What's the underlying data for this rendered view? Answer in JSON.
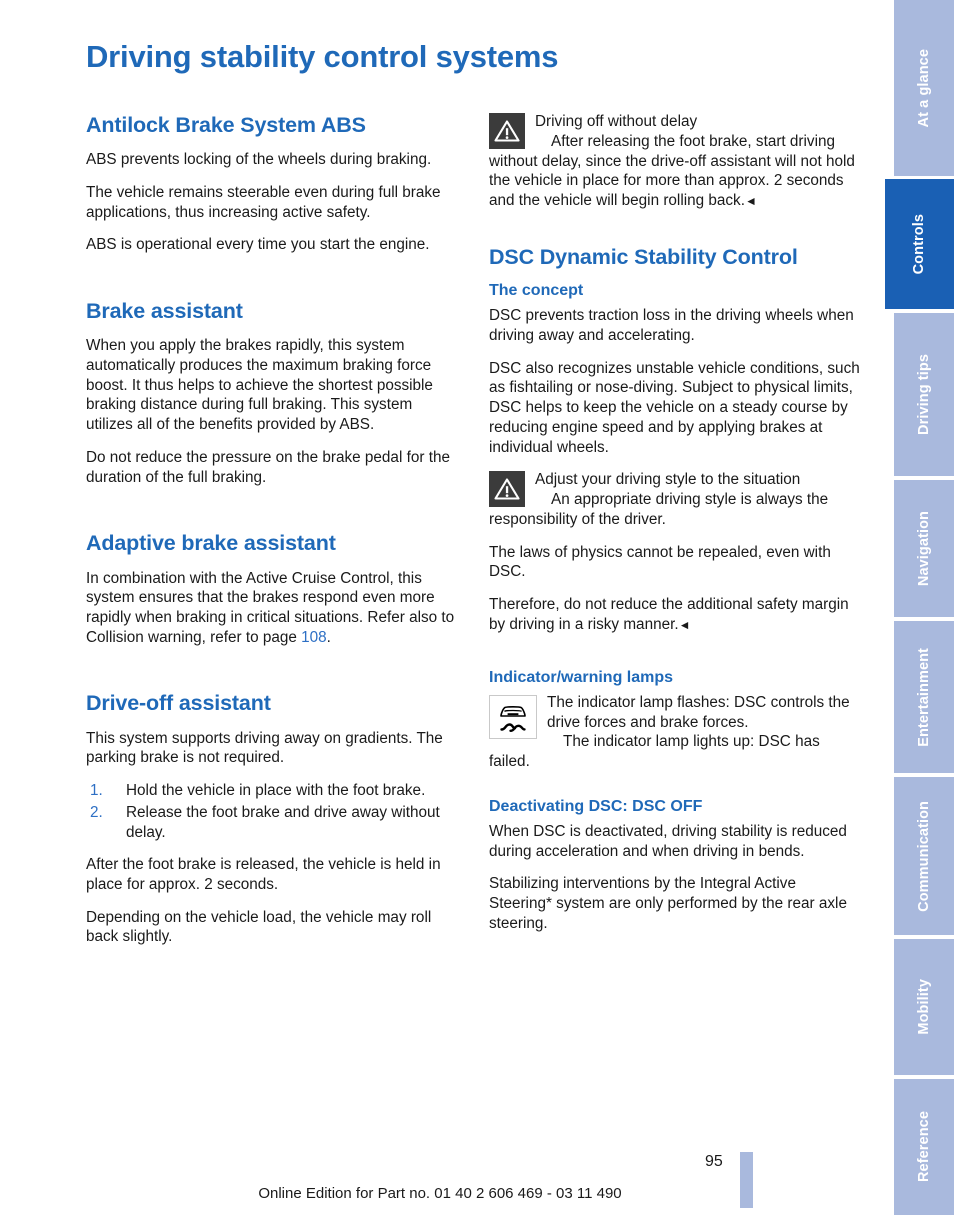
{
  "page": {
    "title": "Driving stability control systems",
    "number": "95",
    "footer_note": "Online Edition for Part no. 01 40 2 606 469 - 03 11 490",
    "accent_blue": "#1f69b8",
    "tab_active_blue": "#1a60b4",
    "tab_inactive_blue": "#a9b9dd"
  },
  "tabs": [
    {
      "label": "At a glance",
      "active": false
    },
    {
      "label": "Controls",
      "active": true
    },
    {
      "label": "Driving tips",
      "active": false
    },
    {
      "label": "Navigation",
      "active": false
    },
    {
      "label": "Entertainment",
      "active": false
    },
    {
      "label": "Communication",
      "active": false
    },
    {
      "label": "Mobility",
      "active": false
    },
    {
      "label": "Reference",
      "active": false
    }
  ],
  "left_column": {
    "abs": {
      "heading": "Antilock Brake System ABS",
      "p1": "ABS prevents locking of the wheels during braking.",
      "p2": "The vehicle remains steerable even during full brake applications, thus increasing active safety.",
      "p3": "ABS is operational every time you start the engine."
    },
    "brake_assistant": {
      "heading": "Brake assistant",
      "p1": "When you apply the brakes rapidly, this system automatically produces the maximum braking force boost. It thus helps to achieve the shortest possible braking distance during full braking. This system utilizes all of the benefits provided by ABS.",
      "p2": "Do not reduce the pressure on the brake pedal for the duration of the full braking."
    },
    "adaptive_brake_assistant": {
      "heading": "Adaptive brake assistant",
      "p1_before": "In combination with the Active Cruise Control, this system ensures that the brakes respond even more rapidly when braking in critical situations. Refer also to Collision warning, refer to page ",
      "p1_pageref": "108",
      "p1_after": "."
    },
    "drive_off_assistant": {
      "heading": "Drive-off assistant",
      "p1": "This system supports driving away on gradients. The parking brake is not required.",
      "steps": [
        {
          "num": "1.",
          "text": "Hold the vehicle in place with the foot brake."
        },
        {
          "num": "2.",
          "text": "Release the foot brake and drive away without delay."
        }
      ],
      "p2": "After the foot brake is released, the vehicle is held in place for approx. 2 seconds.",
      "p3": "Depending on the vehicle load, the vehicle may roll back slightly."
    }
  },
  "right_column": {
    "notice_drive_off": {
      "icon": "warning-triangle-icon",
      "title": "Driving off without delay",
      "body": "After releasing the foot brake, start driving without delay, since the drive-off assistant will not hold the vehicle in place for more than approx. 2 seconds and the vehicle will begin rolling back.",
      "endmark": "◄"
    },
    "dsc": {
      "heading": "DSC Dynamic Stability Control",
      "concept_heading": "The concept",
      "concept_p1": "DSC prevents traction loss in the driving wheels when driving away and accelerating.",
      "concept_p2": "DSC also recognizes unstable vehicle conditions, such as fishtailing or nose-diving. Subject to physical limits, DSC helps to keep the vehicle on a steady course by reducing engine speed and by applying brakes at individual wheels."
    },
    "notice_driving_style": {
      "icon": "warning-triangle-icon",
      "title": "Adjust your driving style to the situation",
      "body": "An appropriate driving style is always the responsibility of the driver.",
      "after_p1": "The laws of physics cannot be repealed, even with DSC.",
      "after_p2": "Therefore, do not reduce the additional safety margin by driving in a risky manner.",
      "endmark": "◄"
    },
    "indicator_lamps": {
      "heading": "Indicator/warning lamps",
      "icon": "dsc-skid-car-icon",
      "line1": "The indicator lamp flashes: DSC controls the drive forces and brake forces.",
      "line2": "The indicator lamp lights up: DSC has failed."
    },
    "deactivating": {
      "heading": "Deactivating DSC: DSC OFF",
      "p1": "When DSC is deactivated, driving stability is reduced during acceleration and when driving in bends.",
      "p2": "Stabilizing interventions by the Integral Active Steering* system are only performed by the rear axle steering."
    }
  }
}
